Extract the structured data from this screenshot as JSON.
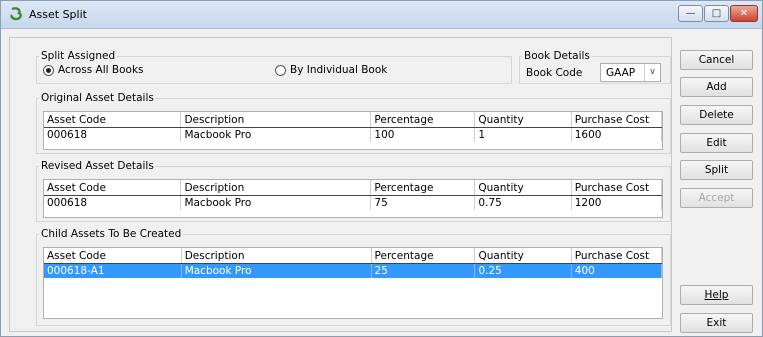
{
  "window": {
    "title": "Asset Split"
  },
  "split_assigned": {
    "legend": "Split Assigned",
    "options": [
      "Across All Books",
      "By Individual Book"
    ],
    "selected": "Across All Books"
  },
  "book_details": {
    "legend": "Book Details",
    "label": "Book Code",
    "value": "GAAP"
  },
  "columns": [
    "Asset Code",
    "Description",
    "Percentage",
    "Quantity",
    "Purchase Cost"
  ],
  "original": {
    "legend": "Original Asset Details",
    "rows": [
      [
        "000618",
        "Macbook Pro",
        "100",
        "1",
        "1600"
      ]
    ]
  },
  "revised": {
    "legend": "Revised Asset Details",
    "rows": [
      [
        "000618",
        "Macbook Pro",
        "75",
        "0.75",
        "1200"
      ]
    ]
  },
  "child": {
    "legend": "Child Assets To Be Created",
    "rows": [
      [
        "000618-A1",
        "Macbook Pro",
        "25",
        "0.25",
        "400"
      ]
    ]
  },
  "buttons": {
    "cancel": "Cancel",
    "add": "Add",
    "delete": "Delete",
    "edit": "Edit",
    "split": "Split",
    "accept": "Accept",
    "help": "Help",
    "exit": "Exit"
  }
}
